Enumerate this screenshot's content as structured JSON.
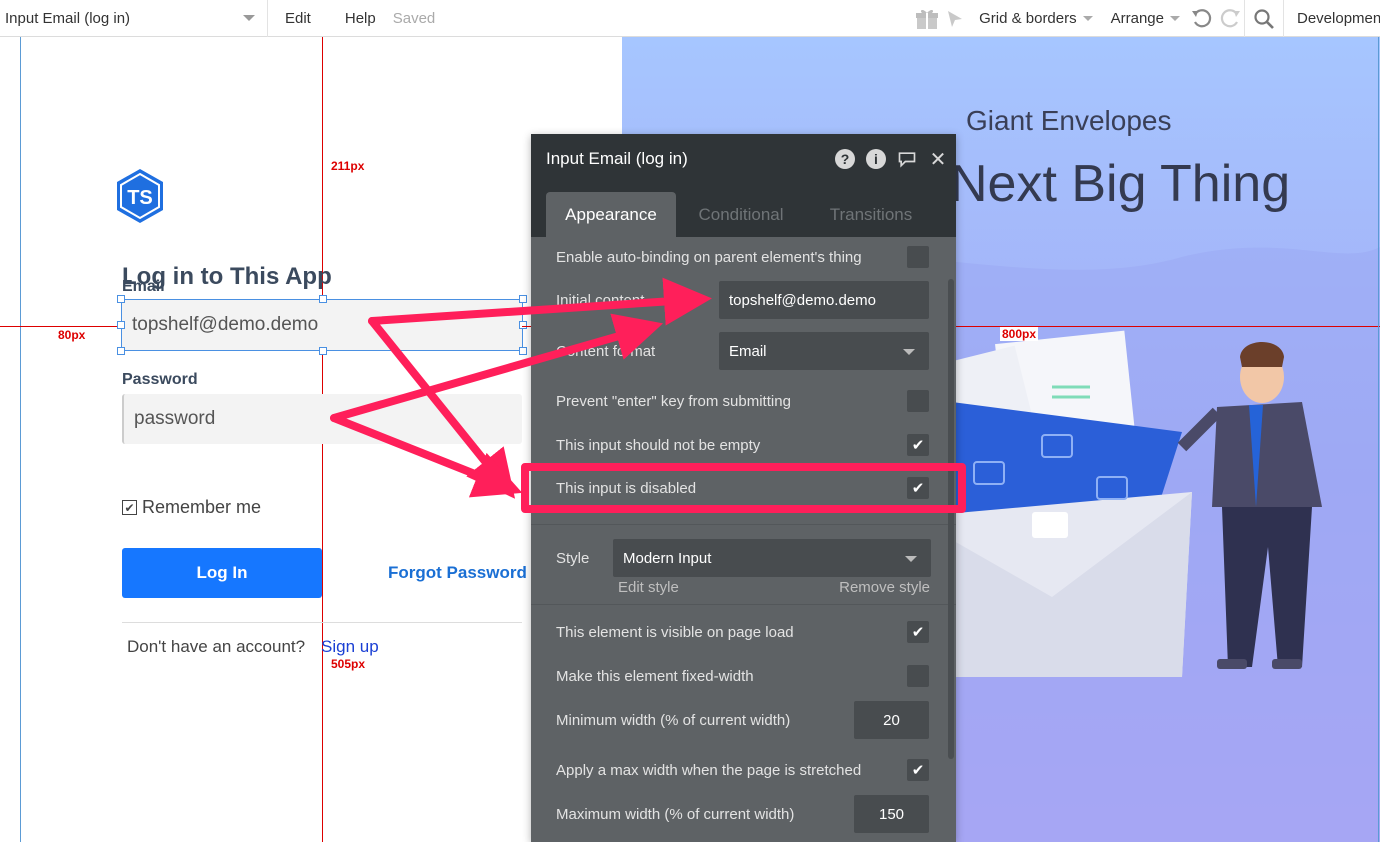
{
  "topbar": {
    "element_select": "Input Email (log in)",
    "menu_edit": "Edit",
    "menu_help": "Help",
    "status_saved": "Saved",
    "grid_menu": "Grid & borders",
    "arrange_menu": "Arrange",
    "env": "Development"
  },
  "guides": {
    "top_distance": "211px",
    "left_distance": "80px",
    "right_distance": "800px",
    "bottom_distance": "505px"
  },
  "login": {
    "logo_text": "TS",
    "title": "Log in to This App",
    "email_label": "Email",
    "email_value": "topshelf@demo.demo",
    "password_label": "Password",
    "password_value": "password",
    "remember_label": "Remember me",
    "login_button": "Log In",
    "forgot_link": "Forgot Password",
    "no_account": "Don't have an account?",
    "signup_link": "Sign up"
  },
  "hero": {
    "subtitle": "Giant Envelopes",
    "title": "Next Big Thing"
  },
  "panel": {
    "title": "Input Email (log in)",
    "tabs": [
      "Appearance",
      "Conditional",
      "Transitions"
    ],
    "auto_binding_label": "Enable auto-binding on parent element's thing",
    "initial_content_label": "Initial content",
    "initial_content_value": "topshelf@demo.demo",
    "content_format_label": "Content format",
    "content_format_value": "Email",
    "prevent_enter_label": "Prevent \"enter\" key from submitting",
    "not_empty_label": "This input should not be empty",
    "disabled_label": "This input is disabled",
    "style_label": "Style",
    "style_value": "Modern Input",
    "edit_style": "Edit style",
    "remove_style": "Remove style",
    "visible_label": "This element is visible on page load",
    "fixed_width_label": "Make this element fixed-width",
    "min_width_label": "Minimum width (% of current width)",
    "min_width_value": "20",
    "max_width_toggle_label": "Apply a max width when the page is stretched",
    "max_width_label": "Maximum width (% of current width)",
    "max_width_value": "150",
    "checkmark": "✔"
  },
  "colors": {
    "accent_blue": "#1677ff",
    "highlight_pink": "#ff1f5a",
    "panel_bg": "#5e6265",
    "guide_red": "#dd0000"
  }
}
